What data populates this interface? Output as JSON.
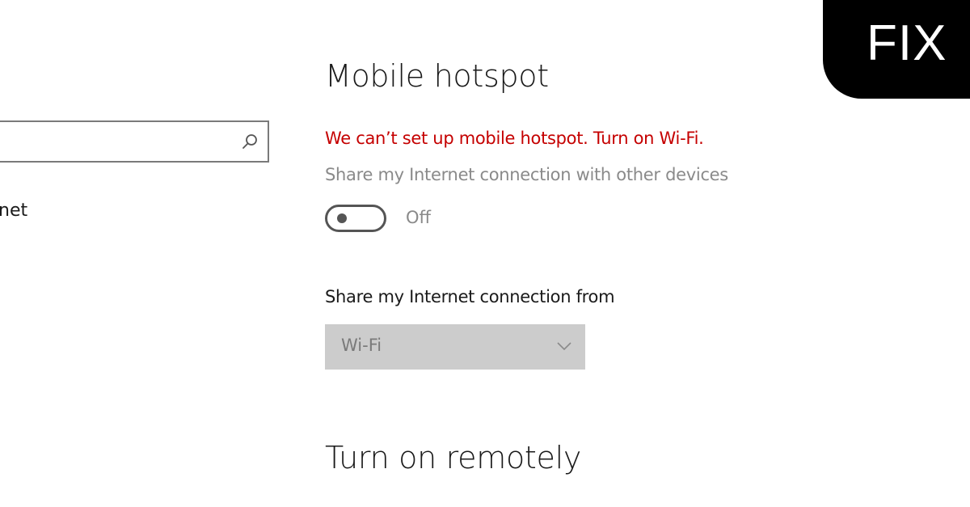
{
  "sidebar": {
    "search": {
      "value": "",
      "icon": "search-icon"
    },
    "items": [
      {
        "label": "net",
        "icon": ""
      }
    ]
  },
  "main": {
    "title": "Mobile hotspot",
    "error_message": "We can’t set up mobile hotspot. Turn on Wi-Fi.",
    "share_description": "Share my Internet connection with other devices",
    "toggle": {
      "state_label": "Off",
      "on": false
    },
    "share_from": {
      "label": "Share my Internet connection from",
      "selected": "Wi-Fi",
      "enabled": false
    },
    "remote_section_title": "Turn on remotely"
  },
  "badge": {
    "label": "FIX"
  },
  "colors": {
    "error": "#c50000",
    "disabled_text": "#8a8a8a",
    "dropdown_bg": "#cccccc",
    "badge_bg": "#000000"
  }
}
